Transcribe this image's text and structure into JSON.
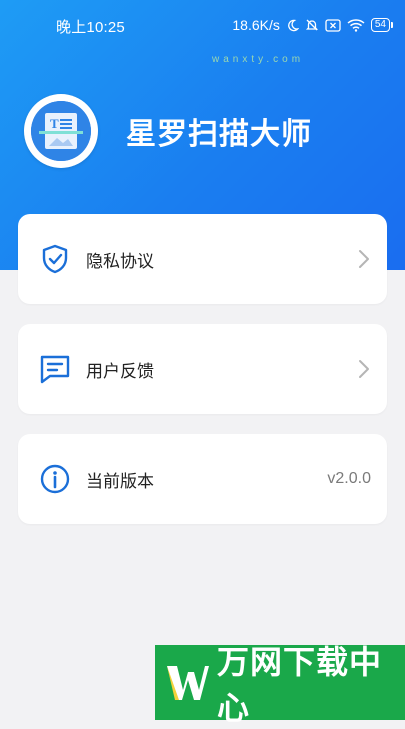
{
  "status_bar": {
    "time": "晚上10:25",
    "network_speed": "18.6K/s",
    "battery": "54",
    "icons": [
      "moon-icon",
      "mute-bell-icon",
      "sim-x-icon",
      "wifi-icon",
      "battery-icon"
    ]
  },
  "app": {
    "name": "星罗扫描大师",
    "logo_icon": "scan-document-icon"
  },
  "menu": [
    {
      "label": "隐私协议",
      "icon": "shield-check-icon",
      "trailing": "chevron-right-icon"
    },
    {
      "label": "用户反馈",
      "icon": "chat-lines-icon",
      "trailing": "chevron-right-icon"
    },
    {
      "label": "当前版本",
      "icon": "info-icon",
      "value": "v2.0.0"
    }
  ],
  "watermark": {
    "text": "万网下载中心",
    "sub": "wanxty.com"
  },
  "colors": {
    "header_gradient_start": "#1e9cf5",
    "header_gradient_end": "#1a6df0",
    "icon_blue": "#1b6fd8",
    "watermark_green": "#1aa84a"
  }
}
